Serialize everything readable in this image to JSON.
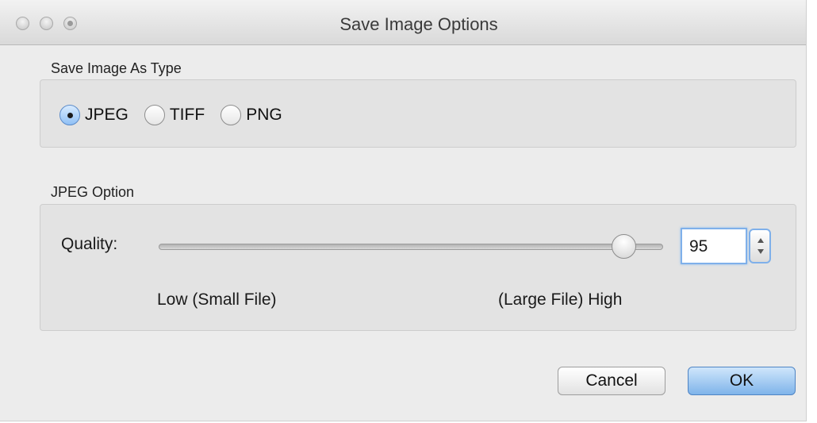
{
  "window": {
    "title": "Save Image Options"
  },
  "save_type": {
    "section_label": "Save Image As Type",
    "options": [
      {
        "label": "JPEG",
        "selected": true
      },
      {
        "label": "TIFF",
        "selected": false
      },
      {
        "label": "PNG",
        "selected": false
      }
    ]
  },
  "jpeg_option": {
    "section_label": "JPEG Option",
    "quality_label": "Quality:",
    "low_label": "Low (Small File)",
    "high_label": "(Large File) High",
    "quality_value": "95",
    "slider_fraction": 0.95
  },
  "buttons": {
    "cancel": "Cancel",
    "ok": "OK"
  },
  "colors": {
    "accent": "#7fb4ea",
    "focus_ring": "#7fb0ea"
  }
}
